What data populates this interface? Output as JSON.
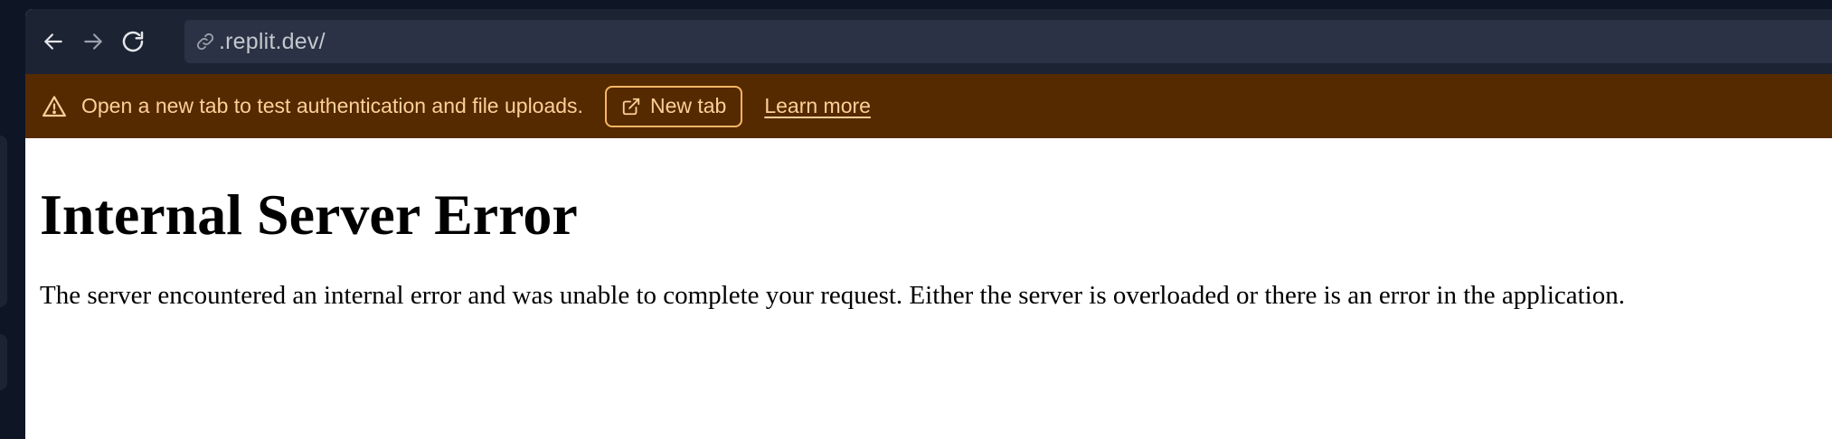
{
  "browser": {
    "back_icon": "arrow-left-icon",
    "forward_icon": "arrow-right-icon",
    "reload_icon": "reload-icon",
    "url": ".replit.dev/",
    "url_icon": "link-icon"
  },
  "banner": {
    "icon": "warning-icon",
    "message": "Open a new tab to test authentication and file uploads.",
    "new_tab_label": "New tab",
    "new_tab_icon": "external-link-icon",
    "learn_more_label": "Learn more",
    "background_color": "#552a00",
    "text_color": "#ffcf98"
  },
  "page": {
    "title": "Internal Server Error",
    "body": "The server encountered an internal error and was unable to complete your request. Either the server is overloaded or there is an error in the application."
  },
  "theme": {
    "toolbar_color": "#1c2333",
    "url_field_color": "#2b3245"
  }
}
